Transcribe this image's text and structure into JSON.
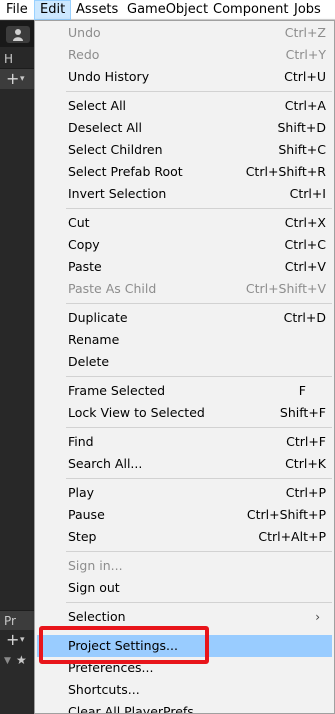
{
  "menubar": {
    "items": [
      {
        "label": "File"
      },
      {
        "label": "Edit",
        "active": true
      },
      {
        "label": "Assets"
      },
      {
        "label": "GameObject"
      },
      {
        "label": "Component"
      },
      {
        "label": "Jobs"
      }
    ]
  },
  "background": {
    "hierarchy_tab_label": "H",
    "project_tab_label": "Pr",
    "add_glyph": "+",
    "dropdown_arrow_glyph": "▾",
    "star_glyph": "★",
    "expand_glyph": "▼"
  },
  "edit_menu": {
    "items": [
      {
        "label": "Undo",
        "shortcut": "Ctrl+Z",
        "enabled": false
      },
      {
        "label": "Redo",
        "shortcut": "Ctrl+Y",
        "enabled": false
      },
      {
        "label": "Undo History",
        "shortcut": "Ctrl+U",
        "enabled": true
      },
      {
        "label": "Select All",
        "shortcut": "Ctrl+A",
        "enabled": true
      },
      {
        "label": "Deselect All",
        "shortcut": "Shift+D",
        "enabled": true
      },
      {
        "label": "Select Children",
        "shortcut": "Shift+C",
        "enabled": true
      },
      {
        "label": "Select Prefab Root",
        "shortcut": "Ctrl+Shift+R",
        "enabled": true
      },
      {
        "label": "Invert Selection",
        "shortcut": "Ctrl+I",
        "enabled": true
      },
      {
        "label": "Cut",
        "shortcut": "Ctrl+X",
        "enabled": true
      },
      {
        "label": "Copy",
        "shortcut": "Ctrl+C",
        "enabled": true
      },
      {
        "label": "Paste",
        "shortcut": "Ctrl+V",
        "enabled": true
      },
      {
        "label": "Paste As Child",
        "shortcut": "Ctrl+Shift+V",
        "enabled": false
      },
      {
        "label": "Duplicate",
        "shortcut": "Ctrl+D",
        "enabled": true
      },
      {
        "label": "Rename",
        "shortcut": "",
        "enabled": true
      },
      {
        "label": "Delete",
        "shortcut": "",
        "enabled": true
      },
      {
        "label": "Frame Selected",
        "shortcut": "F",
        "enabled": true
      },
      {
        "label": "Lock View to Selected",
        "shortcut": "Shift+F",
        "enabled": true
      },
      {
        "label": "Find",
        "shortcut": "Ctrl+F",
        "enabled": true
      },
      {
        "label": "Search All...",
        "shortcut": "Ctrl+K",
        "enabled": true
      },
      {
        "label": "Play",
        "shortcut": "Ctrl+P",
        "enabled": true
      },
      {
        "label": "Pause",
        "shortcut": "Ctrl+Shift+P",
        "enabled": true
      },
      {
        "label": "Step",
        "shortcut": "Ctrl+Alt+P",
        "enabled": true
      },
      {
        "label": "Sign in...",
        "shortcut": "",
        "enabled": false
      },
      {
        "label": "Sign out",
        "shortcut": "",
        "enabled": true
      },
      {
        "label": "Selection",
        "shortcut": "",
        "enabled": true,
        "submenu": true,
        "arrow": "›"
      },
      {
        "label": "Project Settings...",
        "shortcut": "",
        "enabled": true,
        "highlighted": true
      },
      {
        "label": "Preferences...",
        "shortcut": "",
        "enabled": true
      },
      {
        "label": "Shortcuts...",
        "shortcut": "",
        "enabled": true
      },
      {
        "label": "Clear All PlayerPrefs",
        "shortcut": "",
        "enabled": true
      }
    ]
  },
  "colors": {
    "highlight": "#99ccff",
    "annotation": "#e8151b",
    "disabled_text": "#8d8d8d"
  }
}
